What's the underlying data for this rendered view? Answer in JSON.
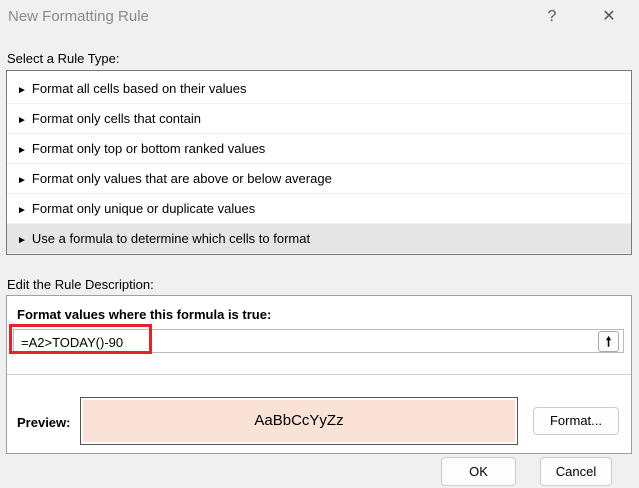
{
  "dialog": {
    "title": "New Formatting Rule",
    "help": "?",
    "close": "✕"
  },
  "rule_type": {
    "label": "Select a Rule Type:",
    "items": [
      "Format all cells based on their values",
      "Format only cells that contain",
      "Format only top or bottom ranked values",
      "Format only values that are above or below average",
      "Format only unique or duplicate values",
      "Use a formula to determine which cells to format"
    ],
    "selected_index": 5
  },
  "description": {
    "label": "Edit the Rule Description:",
    "formula_label": "Format values where this formula is true:",
    "formula_value": "=A2>TODAY()-90",
    "preview_label": "Preview:",
    "preview_text": "AaBbCcYyZz",
    "preview_color": "#fbe2d6",
    "format_button": "Format..."
  },
  "buttons": {
    "ok": "OK",
    "cancel": "Cancel"
  }
}
